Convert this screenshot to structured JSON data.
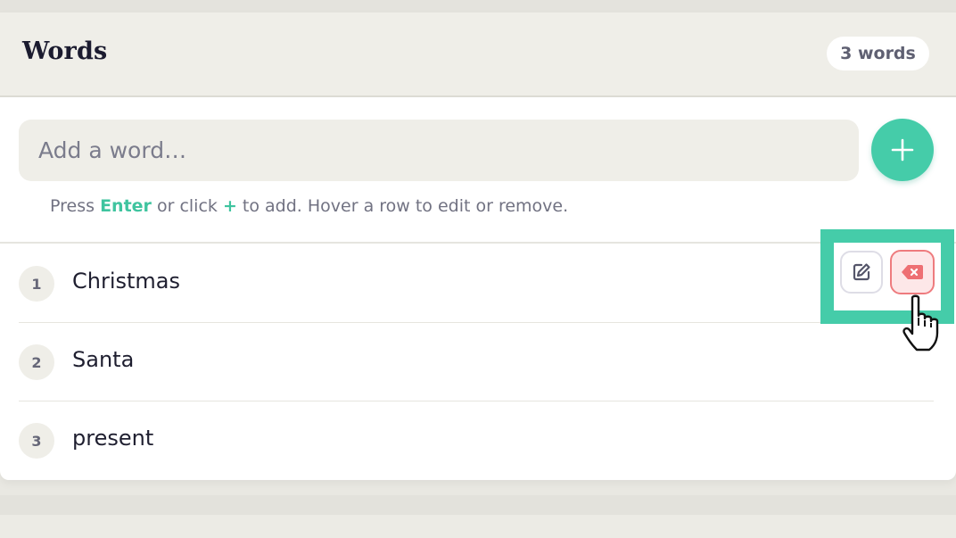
{
  "header": {
    "title": "Words",
    "count_badge": "3 words"
  },
  "add": {
    "placeholder": "Add a word…",
    "button_icon": "plus-icon"
  },
  "hint": {
    "press": "Press",
    "enter_key": "Enter",
    "or_click": "or click",
    "plus_key": "+",
    "rest": "to add. Hover a row to edit or remove."
  },
  "words": [
    {
      "index": "1",
      "text": "Christmas"
    },
    {
      "index": "2",
      "text": "Santa"
    },
    {
      "index": "3",
      "text": "present"
    }
  ],
  "row_actions": {
    "edit_icon": "edit-icon",
    "delete_icon": "backspace-icon"
  },
  "colors": {
    "accent": "#45cca9",
    "danger": "#ee7b7e",
    "header_bg": "#efeee8"
  }
}
